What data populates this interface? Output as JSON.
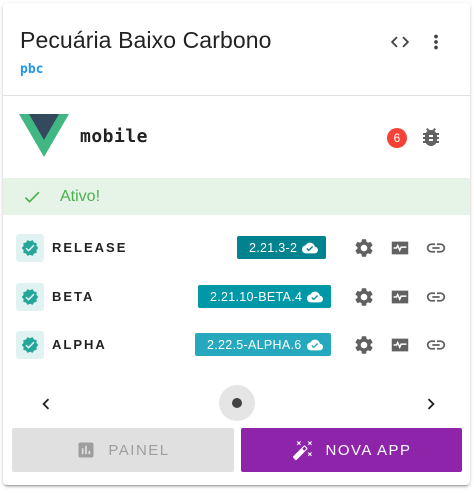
{
  "header": {
    "title": "Pecuária Baixo Carbono",
    "subtitle": "pbc",
    "code_icon": "code-icon",
    "menu_icon": "more-vert-icon"
  },
  "app": {
    "name": "mobile",
    "logo_icon": "vue-logo",
    "issue_count": "6",
    "bug_icon": "bug-icon"
  },
  "status": {
    "text": "Ativo!",
    "color": "#4caf50",
    "background": "#e6f4e7"
  },
  "channels": [
    {
      "name": "RELEASE",
      "version": "2.21.3-2",
      "color": "#00838f"
    },
    {
      "name": "BETA",
      "version": "2.21.10-BETA.4",
      "color": "#0097a7"
    },
    {
      "name": "ALPHA",
      "version": "2.22.5-ALPHA.6",
      "color": "#26a9be"
    }
  ],
  "pager": {
    "prev_icon": "chevron-left-icon",
    "next_icon": "chevron-right-icon"
  },
  "actions": {
    "painel_label": "PAINEL",
    "nova_app_label": "NOVA APP",
    "accent": "#8e24aa"
  }
}
